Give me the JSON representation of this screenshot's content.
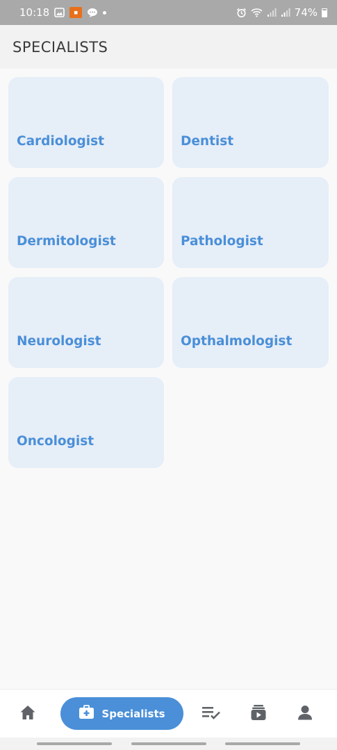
{
  "status_bar": {
    "time": "10:18",
    "battery": "74%",
    "icons": [
      "gallery-icon",
      "notification-app-icon",
      "chat-icon",
      "alarm-icon",
      "wifi-icon",
      "signal-icon",
      "signal-icon",
      "battery-icon"
    ]
  },
  "header": {
    "title": "SPECIALISTS"
  },
  "specialists": [
    {
      "label": "Cardiologist"
    },
    {
      "label": "Dentist"
    },
    {
      "label": "Dermitologist"
    },
    {
      "label": "Pathologist"
    },
    {
      "label": "Neurologist"
    },
    {
      "label": "Opthalmologist"
    },
    {
      "label": "Oncologist"
    }
  ],
  "bottom_nav": {
    "active_label": "Specialists",
    "items": [
      "home-icon",
      "medical-bag-icon",
      "checklist-icon",
      "media-library-icon",
      "person-icon"
    ]
  },
  "colors": {
    "accent": "#4a8fd8",
    "card_background": "#e6eef8",
    "status_bar": "#a9a9a9",
    "header_background": "#f2f2f2"
  }
}
